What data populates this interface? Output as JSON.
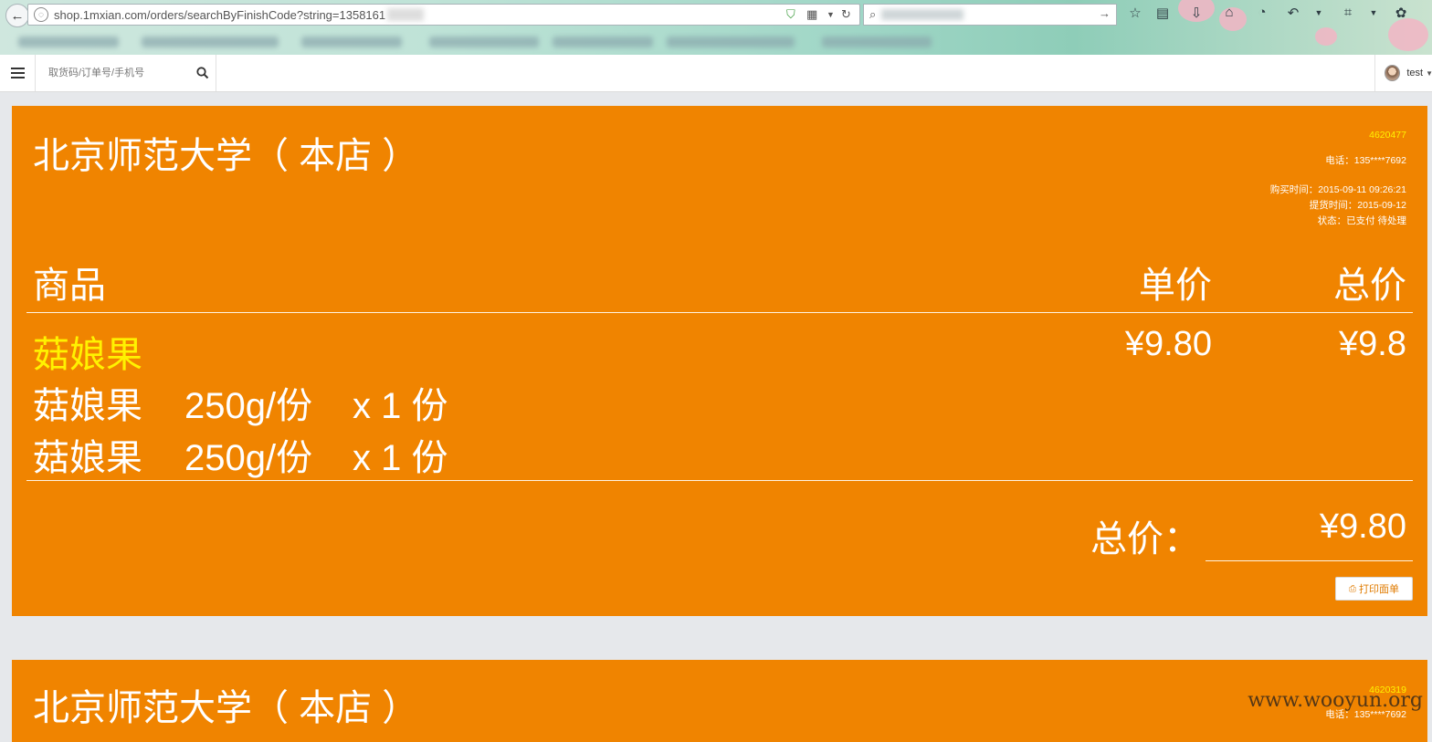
{
  "browser": {
    "url": "shop.1mxian.com/orders/searchByFinishCode?string=1358161",
    "back_glyph": "←",
    "reload_glyph": "↻",
    "go_glyph": "→",
    "search_glyph": "⌕"
  },
  "app": {
    "search_placeholder": "取货码/订单号/手机号",
    "user_name": "test"
  },
  "orders": [
    {
      "store": "北京师范大学（ 本店 ）",
      "order_no": "4620477",
      "phone": "电话：135****7692",
      "purchase_time": "购买时间：2015-09-11 09:26:21",
      "pickup_time": "提货时间：2015-09-12",
      "status": "状态：已支付 待处理",
      "headers": {
        "item": "商品",
        "unit_price": "单价",
        "total_price": "总价"
      },
      "item": {
        "name": "菇娘果",
        "unit_price": "¥9.80",
        "total_price": "¥9.8",
        "lines": [
          {
            "name": "菇娘果",
            "spec": "250g/份",
            "qty": "x 1 份"
          },
          {
            "name": "菇娘果",
            "spec": "250g/份",
            "qty": "x 1 份"
          }
        ]
      },
      "total_label": "总价：",
      "total_value": "¥9.80",
      "print_label": "打印面单"
    },
    {
      "store": "北京师范大学（ 本店 ）",
      "order_no": "4620319",
      "phone": "电话：135****7692"
    }
  ],
  "watermark": "www.wooyun.org",
  "colors": {
    "card": "#f08400",
    "highlight": "#fff200",
    "page_bg": "#e6e8eb"
  }
}
